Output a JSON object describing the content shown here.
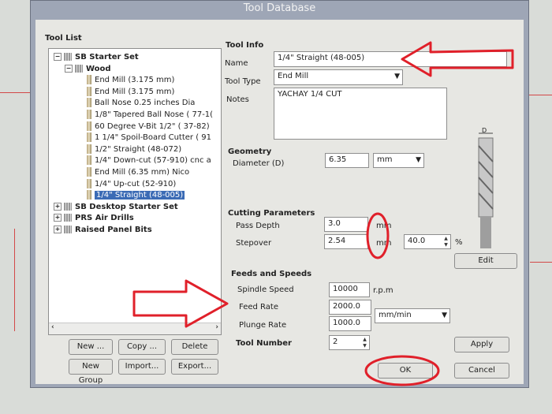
{
  "window": {
    "title": "Tool Database"
  },
  "tool_list": {
    "header": "Tool List",
    "tree": [
      {
        "label": "SB Starter Set",
        "level": 0,
        "kind": "group",
        "expander": "−"
      },
      {
        "label": "Wood",
        "level": 1,
        "kind": "group",
        "expander": "−"
      },
      {
        "label": "End Mill (3.175 mm)",
        "level": 2,
        "kind": "tool"
      },
      {
        "label": "End Mill (3.175 mm)",
        "level": 2,
        "kind": "tool"
      },
      {
        "label": "Ball Nose 0.25 inches Dia",
        "level": 2,
        "kind": "tool"
      },
      {
        "label": "1/8\" Tapered Ball Nose ( 77-1(",
        "level": 2,
        "kind": "tool"
      },
      {
        "label": "60 Degree V-Bit 1/2\" ( 37-82)",
        "level": 2,
        "kind": "tool"
      },
      {
        "label": "1 1/4\" Spoil-Board Cutter ( 91",
        "level": 2,
        "kind": "tool"
      },
      {
        "label": "1/2\" Straight (48-072)",
        "level": 2,
        "kind": "tool"
      },
      {
        "label": "1/4\" Down-cut (57-910) cnc a",
        "level": 2,
        "kind": "tool"
      },
      {
        "label": "End Mill (6.35 mm) Nico",
        "level": 2,
        "kind": "tool"
      },
      {
        "label": "1/4\" Up-cut (52-910)",
        "level": 2,
        "kind": "tool"
      },
      {
        "label": "1/4\" Straight (48-005)",
        "level": 2,
        "kind": "tool",
        "selected": true
      },
      {
        "label": "SB Desktop Starter Set",
        "level": 0,
        "kind": "group",
        "expander": "+"
      },
      {
        "label": "PRS Air Drills",
        "level": 0,
        "kind": "group",
        "expander": "+"
      },
      {
        "label": "Raised Panel Bits",
        "level": 0,
        "kind": "group",
        "expander": "+"
      }
    ],
    "buttons": {
      "new": "New ...",
      "copy": "Copy ...",
      "delete": "Delete",
      "new_group": "New Group",
      "import": "Import...",
      "export": "Export..."
    }
  },
  "tool_info": {
    "header": "Tool Info",
    "name_label": "Name",
    "name_value": "1/4\" Straight (48-005)",
    "type_label": "Tool Type",
    "type_value": "End Mill",
    "notes_label": "Notes",
    "notes_value": "YACHAY 1/4 CUT"
  },
  "geometry": {
    "header": "Geometry",
    "diameter_label": "Diameter (D)",
    "diameter_value": "6.35",
    "unit_value": "mm",
    "diagram_label": "D"
  },
  "cutting": {
    "header": "Cutting Parameters",
    "pass_depth_label": "Pass Depth",
    "pass_depth_value": "3.0",
    "pass_depth_unit": "mm",
    "stepover_label": "Stepover",
    "stepover_value": "2.54",
    "stepover_unit": "mm",
    "stepover_percent": "40.0",
    "percent_sign": "%",
    "edit_button": "Edit"
  },
  "feeds": {
    "header": "Feeds and Speeds",
    "spindle_label": "Spindle Speed",
    "spindle_value": "10000",
    "spindle_unit": "r.p.m",
    "feed_label": "Feed Rate",
    "feed_value": "2000.0",
    "plunge_label": "Plunge Rate",
    "plunge_value": "1000.0",
    "rate_unit": "mm/min"
  },
  "tool_number": {
    "label": "Tool Number",
    "value": "2"
  },
  "actions": {
    "apply": "Apply",
    "ok": "OK",
    "cancel": "Cancel"
  },
  "annotation_color": "#e0202a",
  "selection_color": "#3b6bb5"
}
